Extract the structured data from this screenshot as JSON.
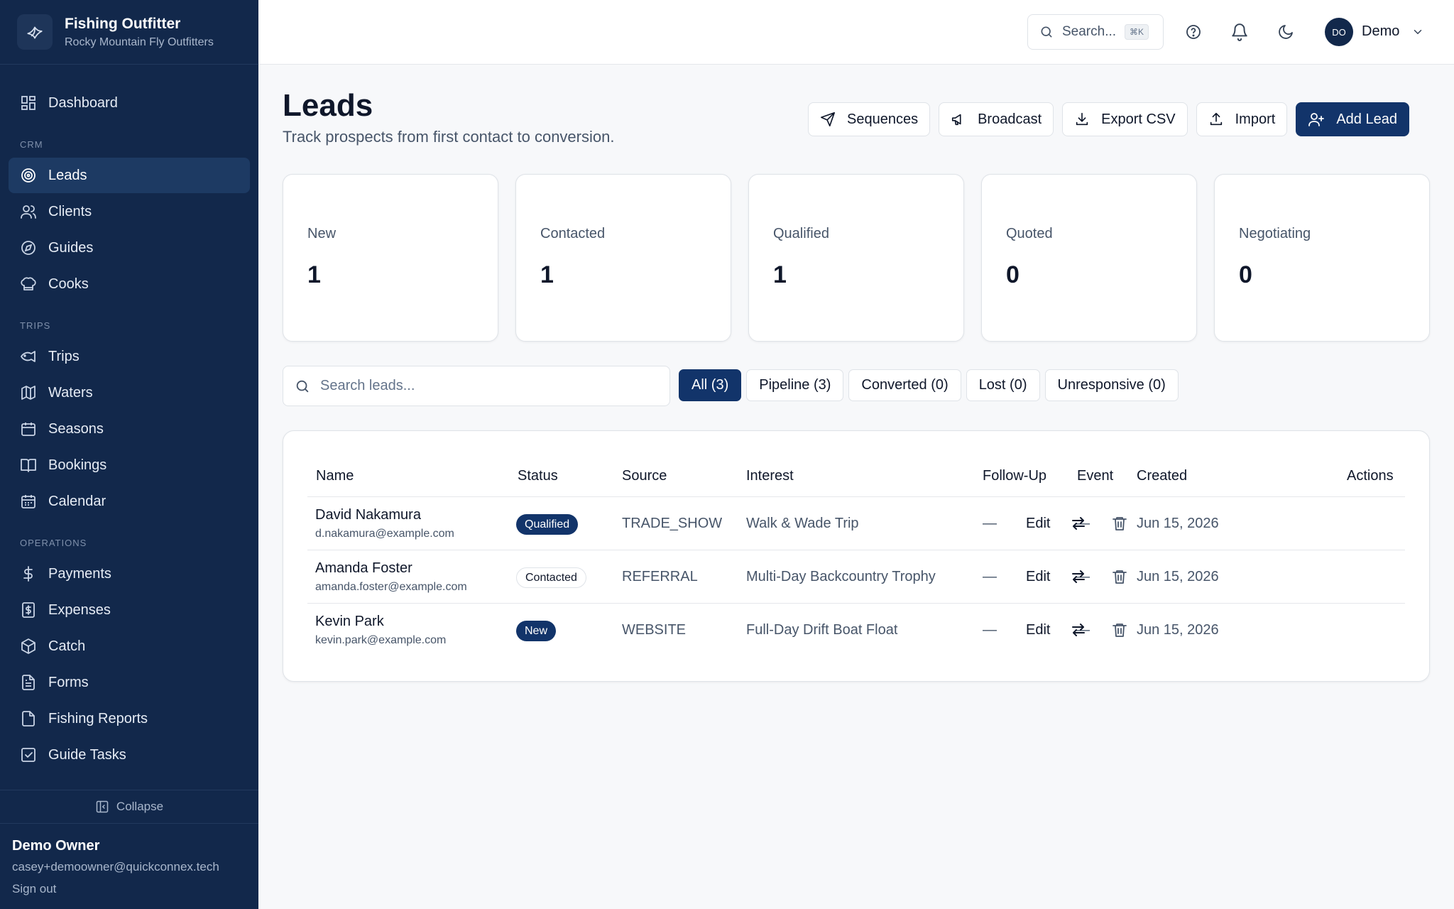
{
  "brand": {
    "name": "Fishing Outfitter",
    "subtitle": "Rocky Mountain Fly Outfitters"
  },
  "sidebar": {
    "items": [
      {
        "label": "Dashboard",
        "icon": "dashboard-icon"
      },
      {
        "section": "CRM"
      },
      {
        "label": "Leads",
        "icon": "target-icon",
        "active": true
      },
      {
        "label": "Clients",
        "icon": "users-icon"
      },
      {
        "label": "Guides",
        "icon": "compass-icon"
      },
      {
        "label": "Cooks",
        "icon": "chef-hat-icon"
      },
      {
        "section": "TRIPS"
      },
      {
        "label": "Trips",
        "icon": "fish-icon"
      },
      {
        "label": "Waters",
        "icon": "map-icon"
      },
      {
        "label": "Seasons",
        "icon": "calendar-icon"
      },
      {
        "label": "Bookings",
        "icon": "book-icon"
      },
      {
        "label": "Calendar",
        "icon": "calendar-days-icon"
      },
      {
        "section": "OPERATIONS"
      },
      {
        "label": "Payments",
        "icon": "dollar-icon"
      },
      {
        "label": "Expenses",
        "icon": "receipt-icon"
      },
      {
        "label": "Catch",
        "icon": "package-icon"
      },
      {
        "label": "Forms",
        "icon": "file-text-icon"
      },
      {
        "label": "Fishing Reports",
        "icon": "file-icon"
      },
      {
        "label": "Guide Tasks",
        "icon": "check-square-icon"
      }
    ],
    "collapse_label": "Collapse",
    "user": {
      "name": "Demo Owner",
      "email": "casey+demoowner@quickconnex.tech",
      "signout": "Sign out"
    }
  },
  "topbar": {
    "search_placeholder": "Search...",
    "shortcut": "⌘K",
    "avatar_initials": "DO",
    "user_label": "Demo"
  },
  "header": {
    "title": "Leads",
    "subtitle": "Track prospects from first contact to conversion."
  },
  "actions": {
    "sequences": "Sequences",
    "broadcast": "Broadcast",
    "export": "Export CSV",
    "import": "Import",
    "add": "Add Lead"
  },
  "stats": [
    {
      "label": "New",
      "value": "1"
    },
    {
      "label": "Contacted",
      "value": "1"
    },
    {
      "label": "Qualified",
      "value": "1"
    },
    {
      "label": "Quoted",
      "value": "0"
    },
    {
      "label": "Negotiating",
      "value": "0"
    }
  ],
  "filters": {
    "search_placeholder": "Search leads...",
    "chips": [
      "All (3)",
      "Pipeline (3)",
      "Converted (0)",
      "Lost (0)",
      "Unresponsive (0)"
    ],
    "active": "All (3)"
  },
  "table": {
    "columns": {
      "name": "Name",
      "status": "Status",
      "source": "Source",
      "interest": "Interest",
      "followup": "Follow-Up",
      "event": "Event",
      "created": "Created",
      "actions": "Actions"
    },
    "rows": [
      {
        "name": "David Nakamura",
        "email": "d.nakamura@example.com",
        "status": "Qualified",
        "source": "TRADE_SHOW",
        "interest": "Walk & Wade Trip",
        "followup": "—",
        "event": "—",
        "created": "Jun 15, 2026",
        "edit": "Edit"
      },
      {
        "name": "Amanda Foster",
        "email": "amanda.foster@example.com",
        "status": "Contacted",
        "source": "REFERRAL",
        "interest": "Multi-Day Backcountry Trophy",
        "followup": "—",
        "event": "—",
        "created": "Jun 15, 2026",
        "edit": "Edit"
      },
      {
        "name": "Kevin Park",
        "email": "kevin.park@example.com",
        "status": "New",
        "source": "WEBSITE",
        "interest": "Full-Day Drift Boat Float",
        "followup": "—",
        "event": "—",
        "created": "Jun 15, 2026",
        "edit": "Edit"
      }
    ]
  },
  "colors": {
    "sidebar": "#12284b",
    "primary": "#12346a",
    "background": "#f7f8fa"
  }
}
